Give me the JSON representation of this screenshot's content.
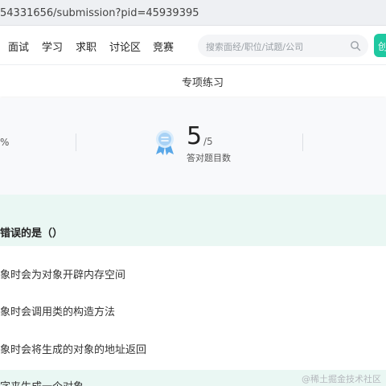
{
  "browser": {
    "url": "54331656/submission?pid=45939395"
  },
  "nav": {
    "items": [
      "面试",
      "学习",
      "求职",
      "讨论区",
      "竞赛"
    ],
    "search_placeholder": "搜索面经/职位/试题/公司",
    "corner_button": "创"
  },
  "subnav": {
    "title": "专项练习"
  },
  "stats": {
    "left_unit": "%",
    "correct_count": "5",
    "total": "/5",
    "correct_label": "答对题目数"
  },
  "question": {
    "text": "错误的是（）",
    "options": [
      "象时会为对象开辟内存空间",
      "象时会调用类的构造方法",
      "象时会将生成的对象的地址返回",
      "字来生成一个对象"
    ]
  },
  "watermark": "@稀土掘金技术社区",
  "colors": {
    "accent": "#1ec8a0",
    "highlight": "#eaf7f3"
  }
}
